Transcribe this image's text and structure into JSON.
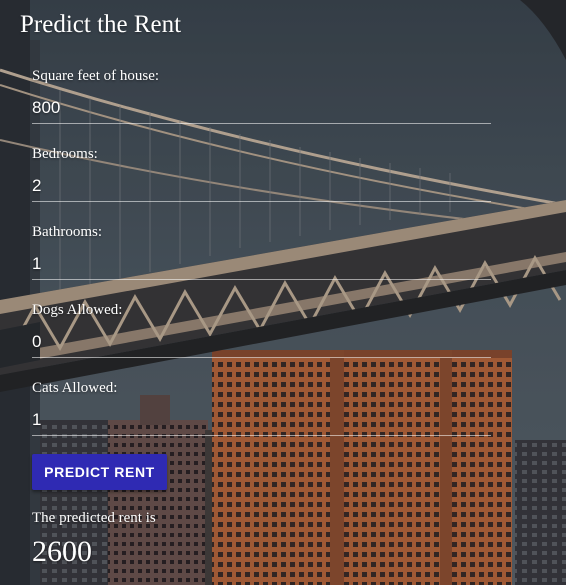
{
  "page": {
    "title": "Predict the Rent"
  },
  "form": {
    "fields": [
      {
        "label": "Square feet of house:",
        "value": "800"
      },
      {
        "label": "Bedrooms:",
        "value": "2"
      },
      {
        "label": "Bathrooms:",
        "value": "1"
      },
      {
        "label": "Dogs Allowed:",
        "value": "0"
      },
      {
        "label": "Cats Allowed:",
        "value": "1"
      }
    ],
    "submit_label": "PREDICT RENT"
  },
  "result": {
    "label": "The predicted rent is",
    "value": "2600"
  },
  "colors": {
    "button": "#2f2ab3",
    "sky": "#4a5560",
    "bridge": "#b09c88",
    "building": "#b8653c"
  },
  "background": {
    "icon": "bridge-city-photo"
  }
}
